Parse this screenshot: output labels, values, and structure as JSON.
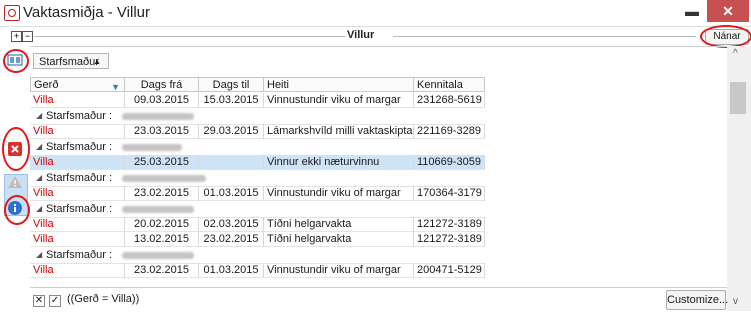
{
  "window": {
    "title": "Vaktasmiðja - Villur",
    "minimize_glyph": "▬",
    "close_glyph": "✕"
  },
  "groupbar": {
    "title": "Villur",
    "nanar_label": "Nánar",
    "expand_glyph": "+",
    "collapse_glyph": "−"
  },
  "grid": {
    "group_by_label": "Starfsmaður",
    "columns": [
      "Gerð",
      "Dags frá",
      "Dags til",
      "Heiti",
      "Kennitala"
    ],
    "group_prefix": "Starfsmaður :",
    "rows": [
      {
        "kind": "data",
        "gerd": "Villa",
        "fra": "09.03.2015",
        "til": "15.03.2015",
        "heiti": "Vinnustundir viku of margar",
        "kt": "231268-5619"
      },
      {
        "kind": "group"
      },
      {
        "kind": "data",
        "gerd": "Villa",
        "fra": "23.03.2015",
        "til": "29.03.2015",
        "heiti": "Lámarkshvíld milli vaktaskipta of oft",
        "kt": "221169-3289"
      },
      {
        "kind": "group"
      },
      {
        "kind": "data",
        "gerd": "Villa",
        "fra": "25.03.2015",
        "til": "",
        "heiti": "Vinnur ekki næturvinnu",
        "kt": "110669-3059",
        "selected": true
      },
      {
        "kind": "group"
      },
      {
        "kind": "data",
        "gerd": "Villa",
        "fra": "23.02.2015",
        "til": "01.03.2015",
        "heiti": "Vinnustundir viku of margar",
        "kt": "170364-3179"
      },
      {
        "kind": "group"
      },
      {
        "kind": "data",
        "gerd": "Villa",
        "fra": "20.02.2015",
        "til": "02.03.2015",
        "heiti": "Tíðni helgarvakta",
        "kt": "121272-3189"
      },
      {
        "kind": "data",
        "gerd": "Villa",
        "fra": "13.02.2015",
        "til": "23.02.2015",
        "heiti": "Tíðni helgarvakta",
        "kt": "121272-3189"
      },
      {
        "kind": "group"
      },
      {
        "kind": "data",
        "gerd": "Villa",
        "fra": "23.02.2015",
        "til": "01.03.2015",
        "heiti": "Vinnustundir viku of margar",
        "kt": "200471-5129"
      }
    ]
  },
  "footer": {
    "filter_text": "((Gerð = Villa))",
    "customize_label": "Customize..."
  },
  "colors": {
    "accent_red": "#d40000",
    "selection": "#cfe3f7",
    "close_bg": "#c75050"
  }
}
